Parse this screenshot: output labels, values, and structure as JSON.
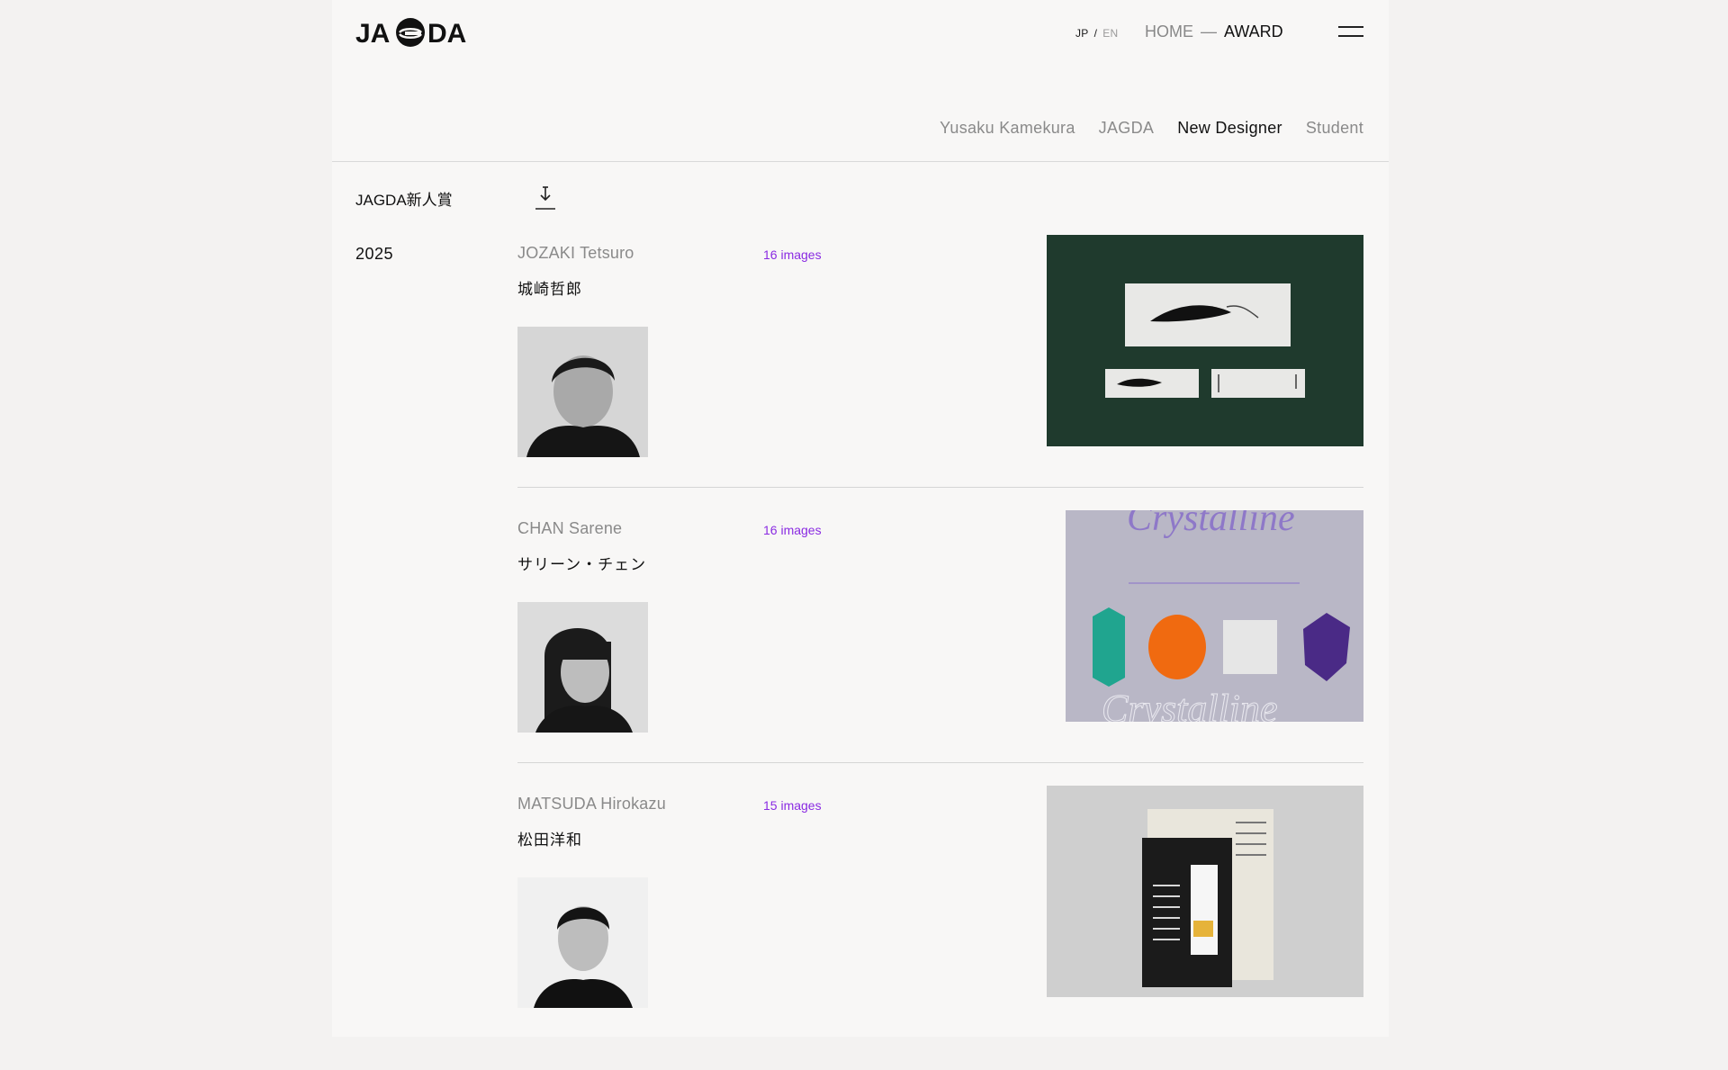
{
  "header": {
    "logo_text": "JAGDA",
    "lang_jp": "JP",
    "lang_sep": "/",
    "lang_en": "EN",
    "breadcrumb_home": "HOME",
    "breadcrumb_dash": "—",
    "breadcrumb_current": "AWARD",
    "menu_icon": "hamburger-icon"
  },
  "subnav": [
    {
      "label": "Yusaku Kamekura",
      "active": false
    },
    {
      "label": "JAGDA",
      "active": false
    },
    {
      "label": "New Designer",
      "active": true
    },
    {
      "label": "Student",
      "active": false
    }
  ],
  "section": {
    "title": "JAGDA新人賞",
    "download_icon": "download-icon",
    "year": "2025"
  },
  "entries": [
    {
      "name_en": "JOZAKI Tetsuro",
      "name_jp": "城崎哲郎",
      "image_count": "16 images"
    },
    {
      "name_en": "CHAN Sarene",
      "name_jp": "サリーン・チェン",
      "image_count": "16 images"
    },
    {
      "name_en": "MATSUDA Hirokazu",
      "name_jp": "松田洋和",
      "image_count": "15 images"
    }
  ],
  "colors": {
    "page_bg": "#f8f7f6",
    "accent_count": "#8a2be2",
    "work1_bg": "#1f3a2d",
    "work2_bg": "#b9b7c6",
    "work3_bg": "#cfcfcf"
  }
}
